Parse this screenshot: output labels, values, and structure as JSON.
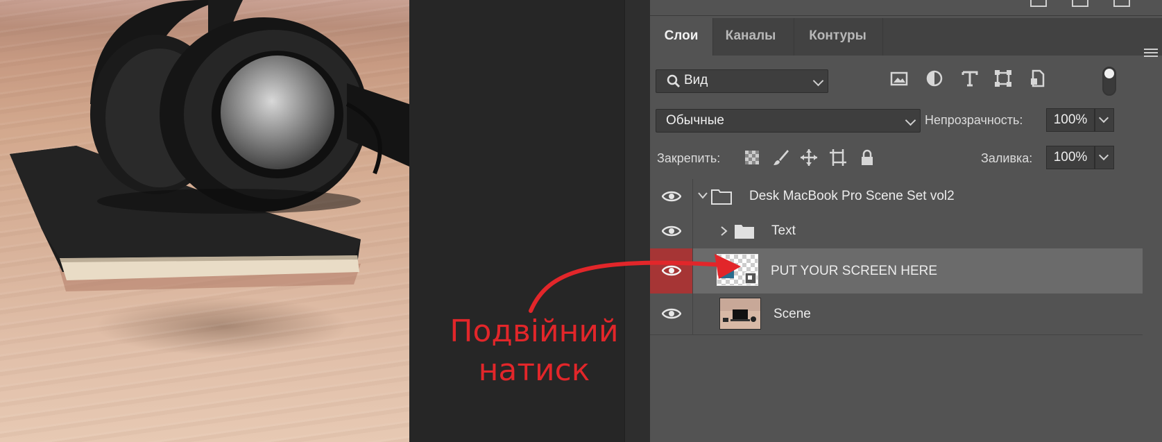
{
  "panel": {
    "tabs": [
      {
        "label": "Слои",
        "active": true
      },
      {
        "label": "Каналы",
        "active": false
      },
      {
        "label": "Контуры",
        "active": false
      }
    ],
    "filter": {
      "kind_label": "Вид",
      "icons": [
        "image-filter-icon",
        "adjustment-filter-icon",
        "type-filter-icon",
        "shape-filter-icon",
        "smart-object-filter-icon"
      ]
    },
    "blend_mode": "Обычные",
    "opacity_label": "Непрозрачность:",
    "opacity_value": "100%",
    "lock_label": "Закрепить:",
    "fill_label": "Заливка:",
    "fill_value": "100%"
  },
  "layers": [
    {
      "name": "Desk MacBook Pro Scene Set vol2",
      "type": "group",
      "expanded": true,
      "visible": true
    },
    {
      "name": "Text",
      "type": "group",
      "expanded": false,
      "visible": true
    },
    {
      "name": "PUT YOUR SCREEN HERE",
      "type": "smart-object",
      "selected": true,
      "visible": true
    },
    {
      "name": "Scene",
      "type": "layer",
      "visible": true
    }
  ],
  "annotation": {
    "line1": "Подвійний",
    "line2": "натиск",
    "color": "#e2262a"
  },
  "colors": {
    "selection_eye": "#a63535",
    "panel_bg": "#535353",
    "tabs_bg": "#424242",
    "canvas_bg": "#262626"
  }
}
